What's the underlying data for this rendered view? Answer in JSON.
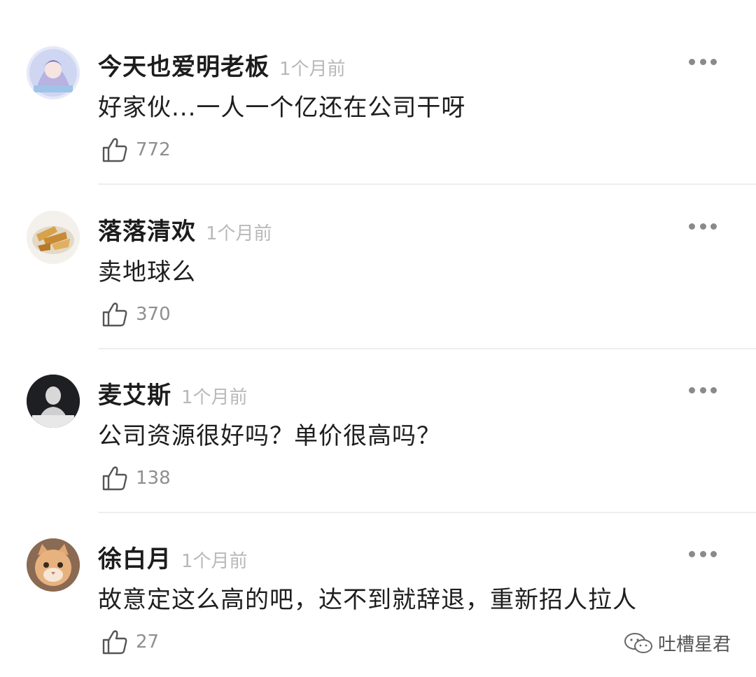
{
  "comments": [
    {
      "username": "今天也爱明老板",
      "time": "1个月前",
      "text": "好家伙...一人一个亿还在公司干呀",
      "likes": "772"
    },
    {
      "username": "落落清欢",
      "time": "1个月前",
      "text": "卖地球么",
      "likes": "370"
    },
    {
      "username": "麦艾斯",
      "time": "1个月前",
      "text": "公司资源很好吗？单价很高吗？",
      "likes": "138"
    },
    {
      "username": "徐白月",
      "time": "1个月前",
      "text": "故意定这么高的吧，达不到就辞退，重新招人拉人",
      "likes": "27"
    }
  ],
  "watermark": {
    "text": "吐槽星君",
    "icon": "wechat-icon"
  },
  "icons": {
    "like": "thumbs-up-icon",
    "more": "more-dots-icon"
  },
  "colors": {
    "username": "#1c1c1c",
    "time": "#b8b8b8",
    "like_count": "#8f8f8f",
    "divider": "#eeeeee"
  }
}
